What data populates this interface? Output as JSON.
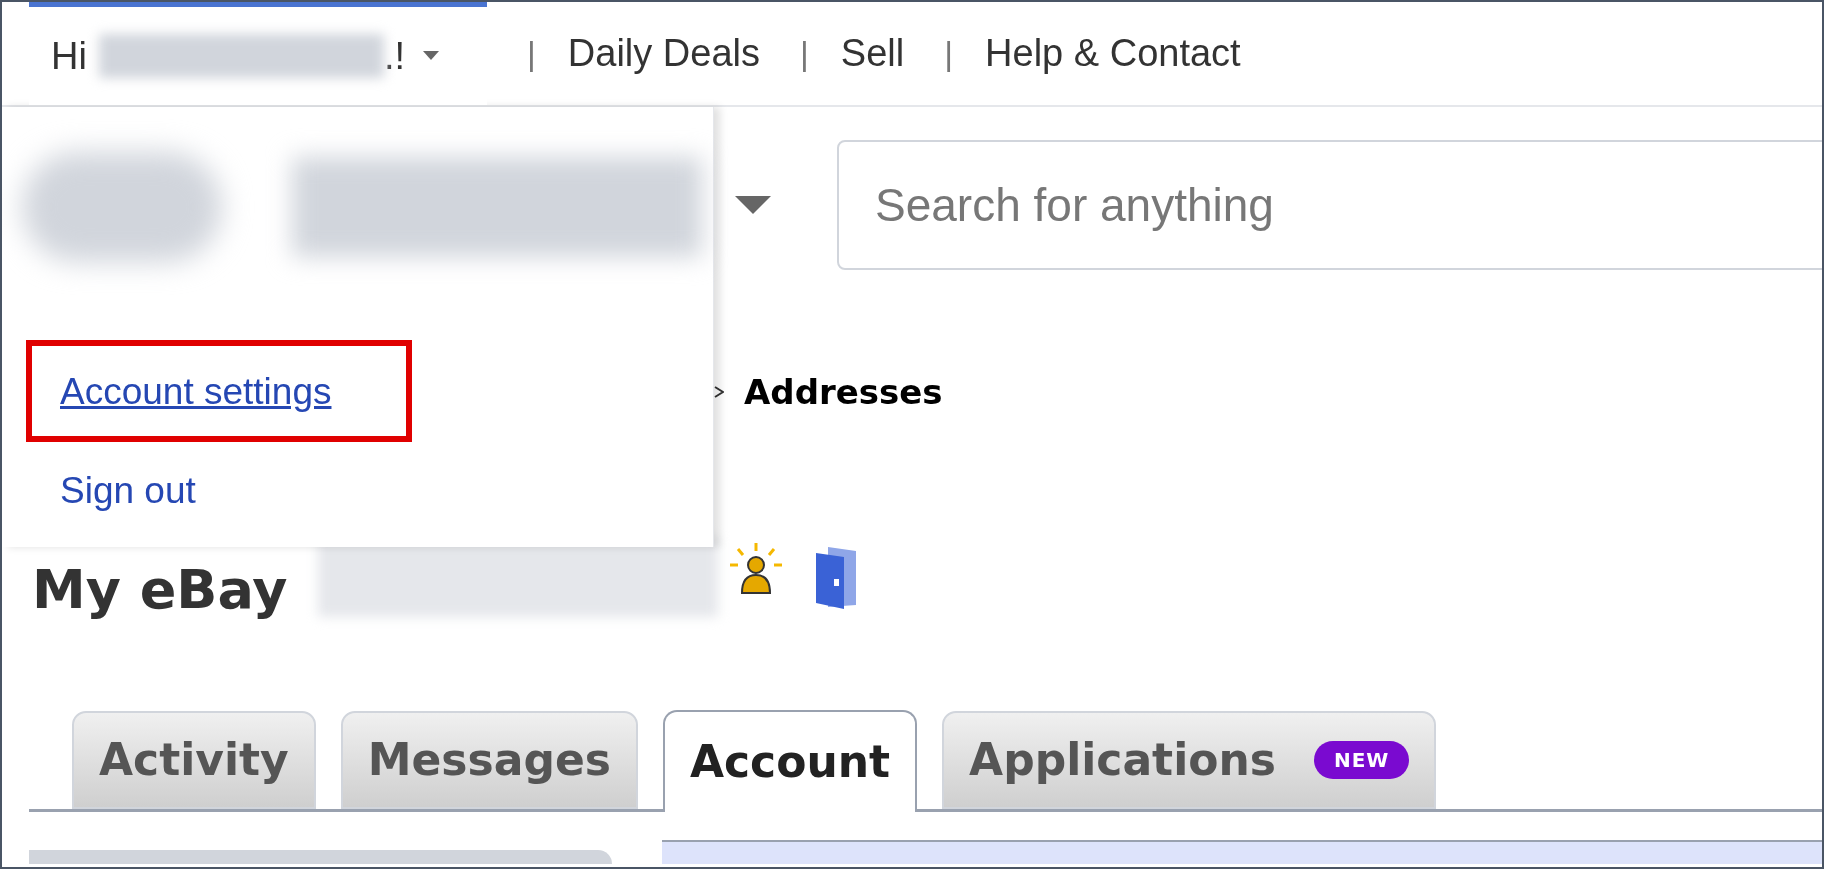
{
  "header": {
    "greeting": {
      "prefix": "Hi",
      "suffix": ".!"
    },
    "links": [
      {
        "separator": "|",
        "label": "Daily Deals"
      },
      {
        "separator": "|",
        "label": "Sell"
      },
      {
        "separator": "|",
        "label": "Help & Contact"
      }
    ]
  },
  "account_menu": {
    "items": [
      {
        "label": "Account settings",
        "highlighted": true
      },
      {
        "label": "Sign out",
        "highlighted": false
      }
    ]
  },
  "search": {
    "placeholder": "Search for anything"
  },
  "breadcrumb": {
    "current": "Addresses"
  },
  "title": "My eBay",
  "tabs": [
    {
      "label": "Activity",
      "selected": false
    },
    {
      "label": "Messages",
      "selected": false
    },
    {
      "label": "Account",
      "selected": true
    },
    {
      "label": "Applications",
      "selected": false,
      "badge": "NEW"
    }
  ]
}
